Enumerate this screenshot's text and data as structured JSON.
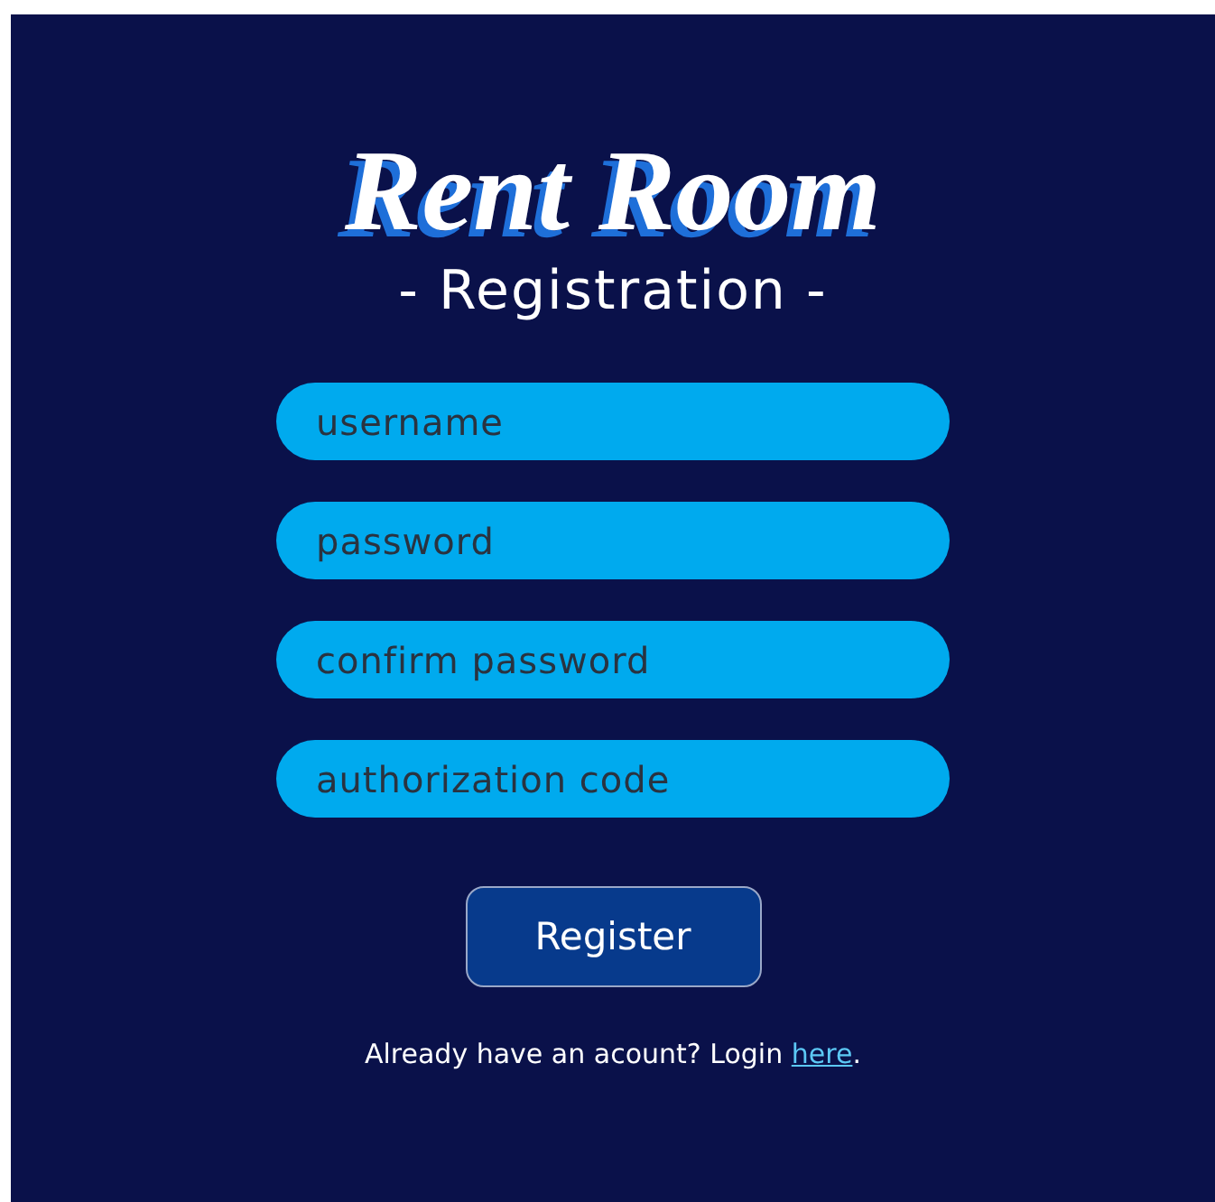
{
  "brand": {
    "title": "Rent Room",
    "subtitle": "- Registration -"
  },
  "fields": [
    {
      "placeholder": "username"
    },
    {
      "placeholder": "password"
    },
    {
      "placeholder": "confirm password"
    },
    {
      "placeholder": "authorization code"
    }
  ],
  "button": {
    "label": "Register"
  },
  "footer": {
    "text": "Already have an acount? Login",
    "link": "here",
    "after": "."
  }
}
